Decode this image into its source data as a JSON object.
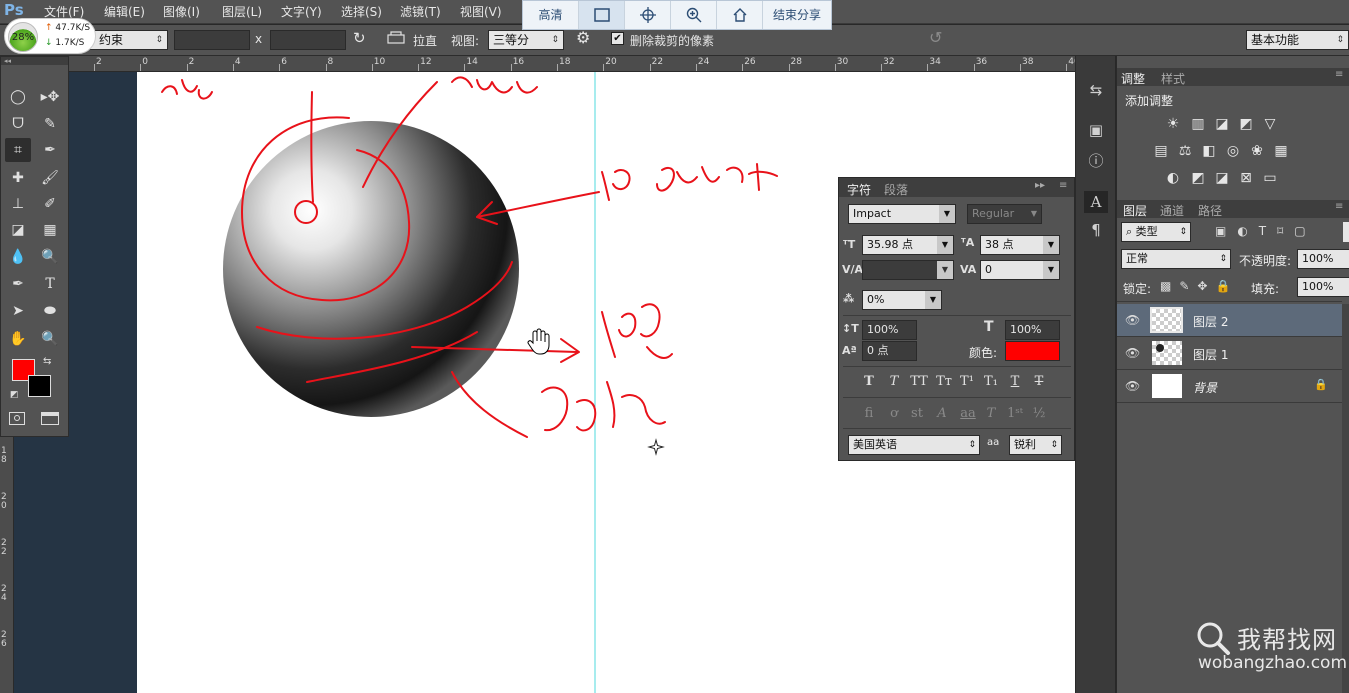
{
  "app": {
    "logo": "Ps"
  },
  "menu": [
    "文件(F)",
    "编辑(E)",
    "图像(I)",
    "图层(L)",
    "文字(Y)",
    "选择(S)",
    "滤镜(T)",
    "视图(V)"
  ],
  "speed_widget": {
    "percent": "28%",
    "upload": "47.7K/S",
    "download": "1.7K/S"
  },
  "share_toolbar": {
    "quality": "高清",
    "end_share": "结束分享"
  },
  "options_bar": {
    "constraint": "约束",
    "x_sep": "x",
    "straighten": "拉直",
    "view_label": "视图:",
    "view_value": "三等分",
    "delete_cropped": "删除裁剪的像素",
    "workspace": "基本功能"
  },
  "ruler_top": [
    "2",
    "0",
    "2",
    "4",
    "6",
    "8",
    "10",
    "12",
    "14",
    "16",
    "18",
    "20",
    "22",
    "24",
    "26",
    "28",
    "30",
    "32",
    "34",
    "36",
    "38",
    "40"
  ],
  "ruler_left": [
    "1\n8",
    "2\n0",
    "2\n2",
    "2\n4",
    "2\n6"
  ],
  "canvas": {
    "annotations": {
      "top_left": "高光",
      "top_mid": "亮面",
      "right": "明暗交界",
      "shadow": "暗",
      "bottom": "反光"
    }
  },
  "character_panel": {
    "tabs": [
      "字符",
      "段落"
    ],
    "font_family": "Impact",
    "font_style": "Regular",
    "font_size": "35.98 点",
    "leading": "38 点",
    "kerning": "",
    "tracking": "0",
    "scale_ratio": "0%",
    "vertical_scale": "100%",
    "horizontal_scale": "100%",
    "baseline_shift": "0 点",
    "color_label": "颜色:",
    "color_value": "#ff0000",
    "language": "美国英语",
    "aa_label": "aa",
    "antialias": "锐利"
  },
  "adjustments_panel": {
    "tabs": [
      "调整",
      "样式"
    ],
    "title": "添加调整"
  },
  "layers_panel": {
    "tabs": [
      "图层",
      "通道",
      "路径"
    ],
    "filter_kind": "类型",
    "blend_mode": "正常",
    "opacity_label": "不透明度:",
    "opacity_value": "100%",
    "lock_label": "锁定:",
    "fill_label": "填充:",
    "fill_value": "100%",
    "layers": [
      {
        "name": "图层 2",
        "selected": true
      },
      {
        "name": "图层 1",
        "selected": false
      },
      {
        "name": "背景",
        "selected": false
      }
    ]
  },
  "watermark": {
    "brand": "我帮找网",
    "url": "wobangzhao.com"
  },
  "colors": {
    "foreground": "#ff0000",
    "background": "#000000",
    "pasteboard": "#253444",
    "accent_stroke": "#e8121a"
  }
}
